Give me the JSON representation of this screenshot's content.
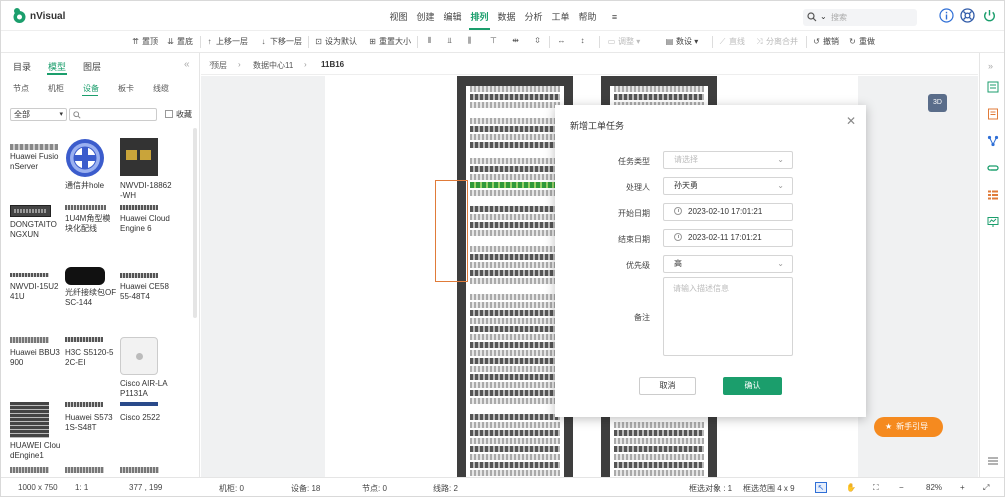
{
  "app": {
    "name": "nVisual"
  },
  "menu": [
    "视图",
    "创建",
    "编辑",
    "排列",
    "数据",
    "分析",
    "工单",
    "帮助",
    "≡"
  ],
  "menu_active": "排列",
  "search": {
    "placeholder": "搜索"
  },
  "toolbar": {
    "top": "置顶",
    "bottom": "置底",
    "up": "上移一层",
    "down": "下移一层",
    "set_default": "设为默认",
    "reset_size": "重置大小",
    "adjust": "调整",
    "data": "数设",
    "line": "直线",
    "split_merge": "分离合并",
    "undo": "撤销",
    "redo": "重做"
  },
  "left": {
    "tabs": [
      "目录",
      "模型",
      "图层"
    ],
    "active_tab": "模型",
    "subtabs": [
      "节点",
      "机柜",
      "设备",
      "板卡",
      "线缆"
    ],
    "active_subtab": "设备",
    "filter": "全部",
    "favorite": "收藏",
    "devices": [
      "Huawei FusionServer",
      "通信井hole",
      "NWVDI-18862-WH",
      "DONGTAITONGXUN",
      "1U4M角型模块化配线",
      "Huawei CloudEngine 6",
      "NWVDI-15U241U",
      "光纤接续包OFSC-144",
      "Huawei CE5855-48T4",
      "Huawei BBU3900",
      "H3C S5120-52C-EI",
      "Cisco AIR-LAP1131A",
      "HUAWEI CloudEngine1",
      "Huawei S5731S-S48T",
      "Cisco 2522"
    ]
  },
  "breadcrumb": [
    "顶层",
    "数据中心11",
    "11B16"
  ],
  "canvas": {
    "btn3d": "3D",
    "guide": "新手引导"
  },
  "modal": {
    "title": "新增工单任务",
    "labels": {
      "type": "任务类型",
      "handler": "处理人",
      "start": "开始日期",
      "end": "结束日期",
      "priority": "优先级",
      "remark": "备注"
    },
    "type_placeholder": "请选择",
    "handler": "孙天勇",
    "start": "2023-02-10 17:01:21",
    "end": "2023-02-11 17:01:21",
    "priority": "高",
    "remark_placeholder": "请输入描述信息",
    "cancel": "取消",
    "ok": "确认"
  },
  "status": {
    "size": "1000 x 750",
    "scale": "1: 1",
    "coords": "377 , 199",
    "cabinets": "机柜: 0",
    "devices": "设备: 18",
    "nodes": "节点: 0",
    "lines": "线路: 2",
    "selected": "框选对象 : 1",
    "range": "框选范围 4 x 9",
    "zoom": "82%"
  },
  "colors": {
    "accent": "#1b9e6c",
    "orange": "#f58a1f",
    "rack": "#3e3e3e"
  }
}
